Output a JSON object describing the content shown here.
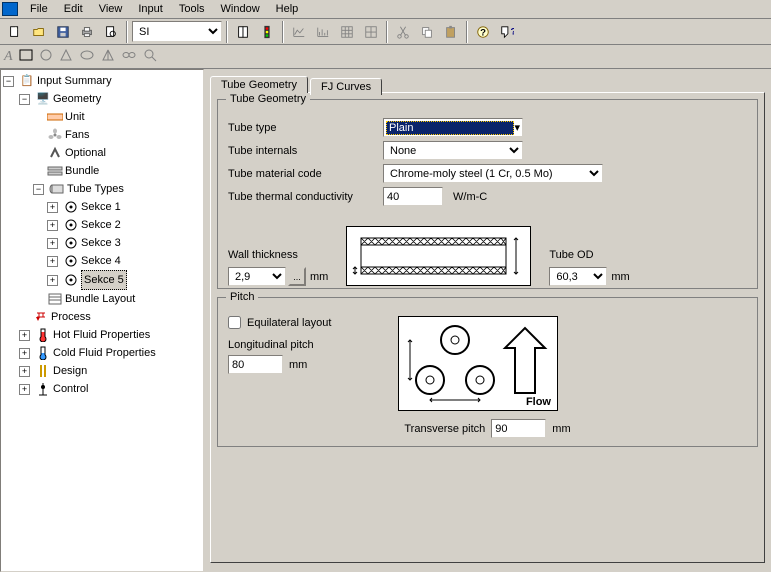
{
  "menu": {
    "file": "File",
    "edit": "Edit",
    "view": "View",
    "input": "Input",
    "tools": "Tools",
    "window": "Window",
    "help": "Help"
  },
  "toolbar": {
    "units_combo": "SI"
  },
  "tree": {
    "root": "Input Summary",
    "geometry": "Geometry",
    "unit": "Unit",
    "fans": "Fans",
    "optional": "Optional",
    "bundle": "Bundle",
    "tube_types": "Tube Types",
    "sekce1": "Sekce 1",
    "sekce2": "Sekce 2",
    "sekce3": "Sekce 3",
    "sekce4": "Sekce 4",
    "sekce5": "Sekce 5",
    "bundle_layout": "Bundle Layout",
    "process": "Process",
    "hot_fluid": "Hot Fluid Properties",
    "cold_fluid": "Cold Fluid Properties",
    "design": "Design",
    "control": "Control"
  },
  "tabs": {
    "tube_geometry": "Tube Geometry",
    "fj_curves": "FJ Curves"
  },
  "group": {
    "tube_geometry": "Tube Geometry",
    "pitch": "Pitch"
  },
  "form": {
    "tube_type_label": "Tube type",
    "tube_type_value": "Plain",
    "tube_internals_label": "Tube internals",
    "tube_internals_value": "None",
    "tube_material_label": "Tube material code",
    "tube_material_value": "Chrome-moly steel (1 Cr, 0.5 Mo)",
    "tube_thermal_label": "Tube thermal conductivity",
    "tube_thermal_value": "40",
    "tube_thermal_unit": "W/m-C",
    "wall_thickness_label": "Wall thickness",
    "wall_thickness_value": "2,9",
    "wall_thickness_unit": "mm",
    "wall_thickness_btn": "...",
    "tube_od_label": "Tube OD",
    "tube_od_value": "60,3",
    "tube_od_unit": "mm",
    "equilateral_label": "Equilateral layout",
    "longpitch_label": "Longitudinal pitch",
    "longpitch_value": "80",
    "longpitch_unit": "mm",
    "transpitch_label": "Transverse pitch",
    "transpitch_value": "90",
    "transpitch_unit": "mm",
    "flow_label": "Flow"
  }
}
